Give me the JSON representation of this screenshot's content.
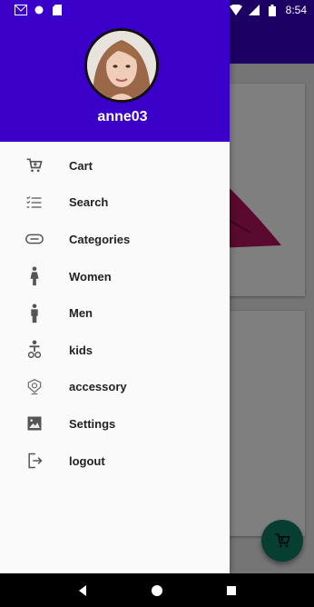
{
  "status_bar": {
    "time": "8:54",
    "left_icons": [
      "gmail-icon",
      "dot-icon",
      "sim-notification-icon"
    ],
    "right_icons": [
      "wifi-icon",
      "signal-icon",
      "battery-icon"
    ]
  },
  "drawer": {
    "username": "anne03",
    "header_color": "#3a00c9",
    "menu": [
      {
        "label": "Cart",
        "icon": "cart-icon"
      },
      {
        "label": "Search",
        "icon": "list-search-icon"
      },
      {
        "label": "Categories",
        "icon": "categories-icon"
      },
      {
        "label": "Women",
        "icon": "woman-icon"
      },
      {
        "label": "Men",
        "icon": "man-icon"
      },
      {
        "label": "kids",
        "icon": "child-icon"
      },
      {
        "label": "accessory",
        "icon": "accessory-icon"
      },
      {
        "label": "Settings",
        "icon": "image-icon"
      },
      {
        "label": "logout",
        "icon": "logout-icon"
      }
    ]
  },
  "colors": {
    "primary": "#3a00c9",
    "fab": "#0f7d64",
    "dress": "#b3145c"
  }
}
